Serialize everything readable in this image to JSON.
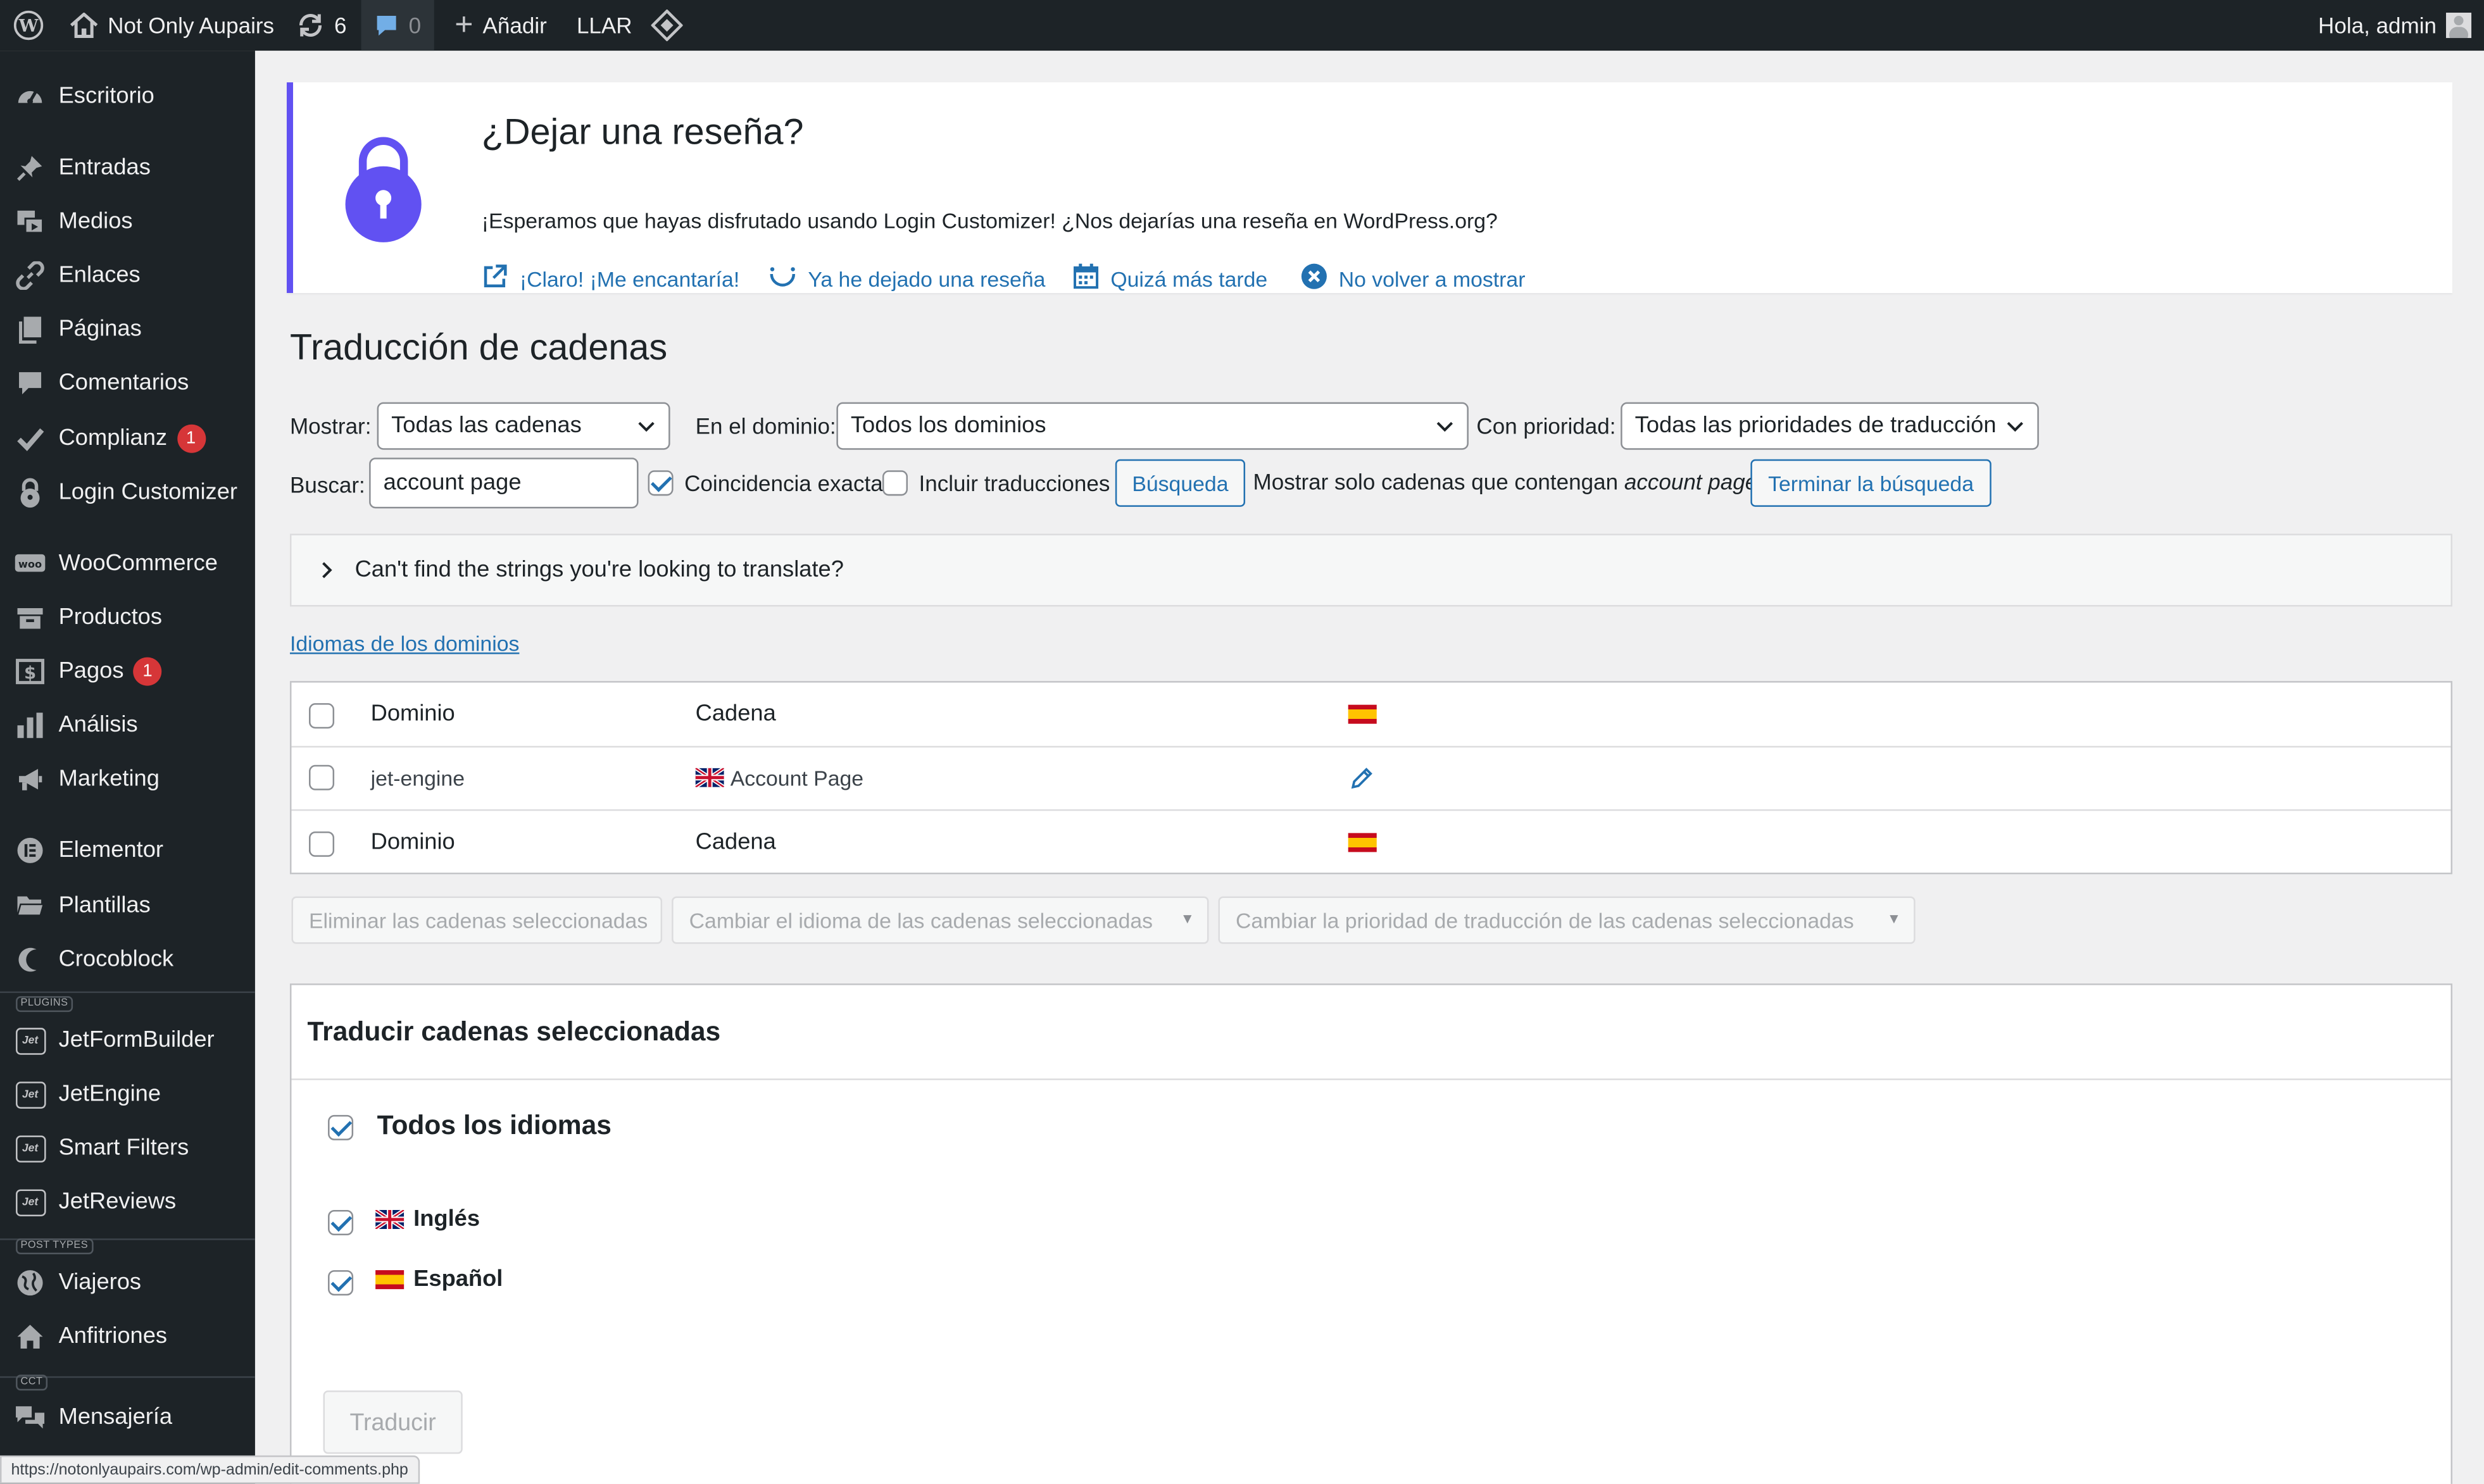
{
  "adminbar": {
    "site_name": "Not Only Aupairs",
    "updates_count": "6",
    "comments_count": "0",
    "add_new": "Añadir",
    "llar": "LLAR",
    "greeting": "Hola, admin"
  },
  "sidebar": {
    "items": [
      {
        "label": "Escritorio",
        "icon": "dashboard-icon"
      },
      {
        "label": "Entradas",
        "icon": "pin-icon"
      },
      {
        "label": "Medios",
        "icon": "media-icon"
      },
      {
        "label": "Enlaces",
        "icon": "link-icon"
      },
      {
        "label": "Páginas",
        "icon": "pages-icon"
      },
      {
        "label": "Comentarios",
        "icon": "comment-icon"
      },
      {
        "label": "Complianz",
        "icon": "check-icon",
        "badge": "1"
      },
      {
        "label": "Login Customizer",
        "icon": "lock-icon"
      },
      {
        "label": "WooCommerce",
        "icon": "woo-icon"
      },
      {
        "label": "Productos",
        "icon": "archive-icon"
      },
      {
        "label": "Pagos",
        "icon": "money-icon",
        "badge": "1"
      },
      {
        "label": "Análisis",
        "icon": "chart-icon"
      },
      {
        "label": "Marketing",
        "icon": "megaphone-icon"
      },
      {
        "label": "Elementor",
        "icon": "elementor-icon"
      },
      {
        "label": "Plantillas",
        "icon": "folder-icon"
      },
      {
        "label": "Crocoblock",
        "icon": "crocoblock-icon"
      },
      {
        "label": "JetFormBuilder",
        "icon": "jet-icon"
      },
      {
        "label": "JetEngine",
        "icon": "jet-icon"
      },
      {
        "label": "Smart Filters",
        "icon": "jet-icon"
      },
      {
        "label": "JetReviews",
        "icon": "jet-icon"
      },
      {
        "label": "Viajeros",
        "icon": "globe-icon"
      },
      {
        "label": "Anfitriones",
        "icon": "home-icon"
      },
      {
        "label": "Mensajería",
        "icon": "chat-icon"
      }
    ],
    "sep_plugins": "PLUGINS",
    "sep_post_types": "POST TYPES",
    "sep_cct": "CCT",
    "jet_glyph": "Jet"
  },
  "notice": {
    "title": "¿Dejar una reseña?",
    "text": "¡Esperamos que hayas disfrutado usando Login Customizer! ¿Nos dejarías una reseña en WordPress.org?",
    "link_yes": "¡Claro! ¡Me encantaría!",
    "link_done": "Ya he dejado una reseña",
    "link_later": "Quizá más tarde",
    "link_never": "No volver a mostrar",
    "accent": "#6151f2"
  },
  "page": {
    "title": "Traducción de cadenas"
  },
  "filters": {
    "show_label": "Mostrar:",
    "show_value": "Todas las cadenas",
    "domain_label": "En el dominio:",
    "domain_value": "Todos los dominios",
    "priority_label": "Con prioridad:",
    "priority_value": "Todas las prioridades de traducción",
    "search_label": "Buscar:",
    "search_value": "account page",
    "exact_label": "Coincidencia exacta",
    "exact_checked": true,
    "include_label": "Incluir traducciones",
    "include_checked": false,
    "search_button": "Búsqueda",
    "showing_prefix": "Mostrar solo cadenas que contengan",
    "showing_term": "account page",
    "end_search_button": "Terminar la búsqueda"
  },
  "help_box": {
    "text": "Can't find the strings you're looking to translate?"
  },
  "domain_languages_link": "Idiomas de los dominios",
  "table": {
    "header": {
      "domain": "Dominio",
      "string": "Cadena"
    },
    "rows": [
      {
        "domain": "jet-engine",
        "string": "Account Page"
      }
    ],
    "footer": {
      "domain": "Dominio",
      "string": "Cadena"
    }
  },
  "bulk_actions": {
    "delete": "Eliminar las cadenas seleccionadas",
    "change_language": "Cambiar el idioma de las cadenas seleccionadas",
    "change_priority": "Cambiar la prioridad de traducción de las cadenas seleccionadas"
  },
  "translate_panel": {
    "title": "Traducir cadenas seleccionadas",
    "all_languages": "Todos los idiomas",
    "languages": [
      {
        "label": "Inglés",
        "checked": true
      },
      {
        "label": "Español",
        "checked": true
      }
    ],
    "button": "Traducir"
  },
  "statusbar": {
    "url": "https://notonlyaupairs.com/wp-admin/edit-comments.php"
  },
  "colors": {
    "admin_dark": "#1d2327",
    "link_blue": "#2271b1",
    "badge_red": "#d63638"
  }
}
